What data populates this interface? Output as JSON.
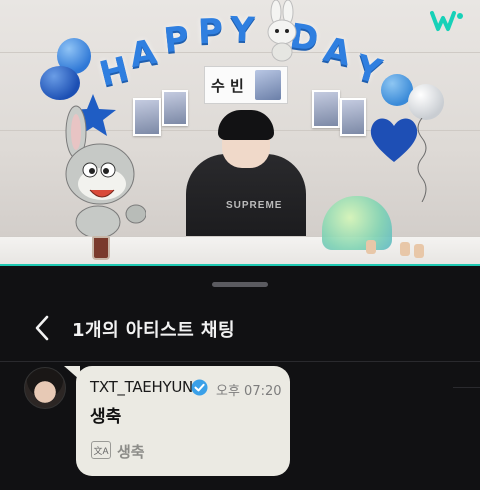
{
  "video": {
    "banner_letters": [
      "H",
      "A",
      "P",
      "P",
      "Y",
      "D",
      "A",
      "Y"
    ],
    "nametag_text": "수 빈",
    "shirt_print": "SUPREME"
  },
  "branding": {
    "logo": "weverse-logo",
    "accent": "#1fc9b3"
  },
  "chat_header": {
    "back_icon": "chevron-left-icon",
    "title": "1개의 아티스트 채팅"
  },
  "message": {
    "sender": "TXT_TAEHYUN",
    "verified": true,
    "time": "오후 07:20",
    "text": "생축",
    "translation_icon": "translate-icon",
    "translation_icon_label": "文A",
    "translation": "생축"
  },
  "colors": {
    "panel_bg": "#111113",
    "bubble_bg": "#ebeae3",
    "verified": "#3aa0e8",
    "banner_blue": "#2f7fe0"
  }
}
